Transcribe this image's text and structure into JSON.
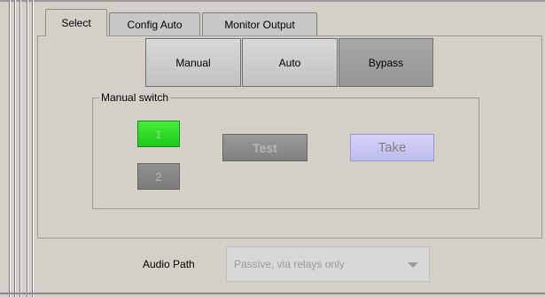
{
  "tabs": [
    {
      "label": "Select",
      "active": true
    },
    {
      "label": "Config Auto",
      "active": false
    },
    {
      "label": "Monitor Output",
      "active": false
    }
  ],
  "mode_buttons": [
    {
      "label": "Manual",
      "selected": false
    },
    {
      "label": "Auto",
      "selected": false
    },
    {
      "label": "Bypass",
      "selected": true
    }
  ],
  "manual_switch": {
    "title": "Manual switch",
    "input_1_label": "1",
    "input_2_label": "2",
    "test_label": "Test",
    "take_label": "Take"
  },
  "audio_path": {
    "label": "Audio Path",
    "value": "Passive, via relays only"
  },
  "colors": {
    "background": "#d4d0c8",
    "input_1_active": "#2ee02a",
    "take_button": "#c8c8f4"
  }
}
